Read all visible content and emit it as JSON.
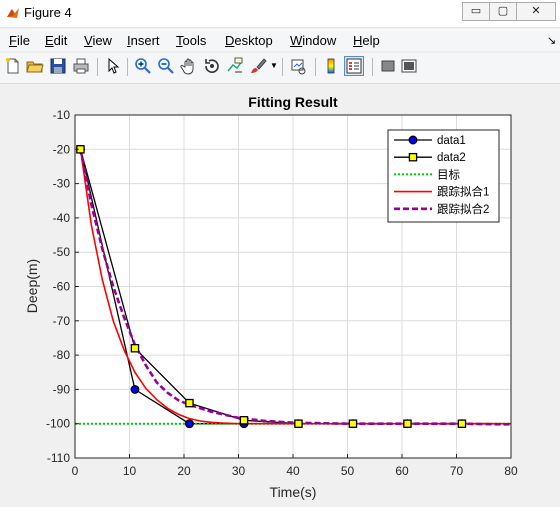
{
  "window": {
    "title": "Figure 4",
    "minimize_glyph": "▭",
    "maximize_glyph": "▢",
    "close_glyph": "✕",
    "restore_arrow": "↘"
  },
  "menu": [
    {
      "label": "File",
      "key": "F",
      "rest": "ile"
    },
    {
      "label": "Edit",
      "key": "E",
      "rest": "dit"
    },
    {
      "label": "View",
      "key": "V",
      "rest": "iew"
    },
    {
      "label": "Insert",
      "key": "I",
      "rest": "nsert"
    },
    {
      "label": "Tools",
      "key": "T",
      "rest": "ools"
    },
    {
      "label": "Desktop",
      "key": "D",
      "rest": "esktop"
    },
    {
      "label": "Window",
      "key": "W",
      "rest": "indow"
    },
    {
      "label": "Help",
      "key": "H",
      "rest": "elp"
    }
  ],
  "toolbar_icons": [
    "new-file-icon",
    "open-folder-icon",
    "save-icon",
    "print-icon",
    "pointer-icon",
    "zoom-in-icon",
    "zoom-out-icon",
    "pan-hand-icon",
    "rotate-3d-icon",
    "data-cursor-icon",
    "brush-icon",
    "dropdown-arrow-icon",
    "link-plot-icon",
    "colorbar-icon",
    "legend-icon",
    "hide-plot-tools-icon",
    "show-plot-tools-icon"
  ],
  "chart_data": {
    "type": "line",
    "title": "Fitting Result",
    "xlabel": "Time(s)",
    "ylabel": "Deep(m)",
    "xlim": [
      0,
      80
    ],
    "ylim": [
      -110,
      -10
    ],
    "xticks": [
      0,
      10,
      20,
      30,
      40,
      50,
      60,
      70,
      80
    ],
    "yticks": [
      -10,
      -20,
      -30,
      -40,
      -50,
      -60,
      -70,
      -80,
      -90,
      -100,
      -110
    ],
    "grid": true,
    "legend_position": "top-right",
    "series": [
      {
        "name": "data1",
        "style": "line-circle",
        "color": "#000000",
        "marker_color": "#0000ff",
        "x": [
          1,
          11,
          21,
          31,
          41,
          51,
          61,
          71
        ],
        "y": [
          -20,
          -90,
          -100,
          -100,
          -100,
          -100,
          -100,
          -100
        ]
      },
      {
        "name": "data2",
        "style": "line-square",
        "color": "#000000",
        "marker_color": "#ffff00",
        "x": [
          1,
          11,
          21,
          31,
          41,
          51,
          61,
          71
        ],
        "y": [
          -20,
          -78,
          -94,
          -99,
          -100,
          -100,
          -100,
          -100
        ]
      },
      {
        "name": "目标",
        "style": "dotted",
        "color": "#00cc00",
        "x": [
          0,
          80
        ],
        "y": [
          -100,
          -100
        ]
      },
      {
        "name": "跟踪拟合1",
        "style": "solid",
        "color": "#ff0000",
        "x": [
          1,
          3,
          5,
          7,
          9,
          11,
          13,
          15,
          17,
          19,
          21,
          23,
          25,
          27,
          30,
          35,
          40,
          50,
          60,
          70,
          80
        ],
        "y": [
          -20,
          -42,
          -58,
          -70,
          -78.5,
          -85,
          -89.7,
          -93,
          -95.5,
          -97.3,
          -98.5,
          -99.2,
          -99.6,
          -99.8,
          -100,
          -100,
          -100,
          -100,
          -100,
          -100,
          -100
        ]
      },
      {
        "name": "跟踪拟合2",
        "style": "dashed",
        "color": "#990099",
        "x": [
          1,
          3,
          5,
          7,
          9,
          11,
          13,
          15,
          17,
          19,
          21,
          25,
          30,
          35,
          40,
          50,
          60,
          70,
          80
        ],
        "y": [
          -20,
          -36,
          -49,
          -60,
          -69,
          -77,
          -83,
          -88,
          -91,
          -93.2,
          -94.5,
          -96.5,
          -98.3,
          -99.2,
          -99.7,
          -100,
          -100,
          -100,
          -100.2
        ]
      }
    ]
  }
}
